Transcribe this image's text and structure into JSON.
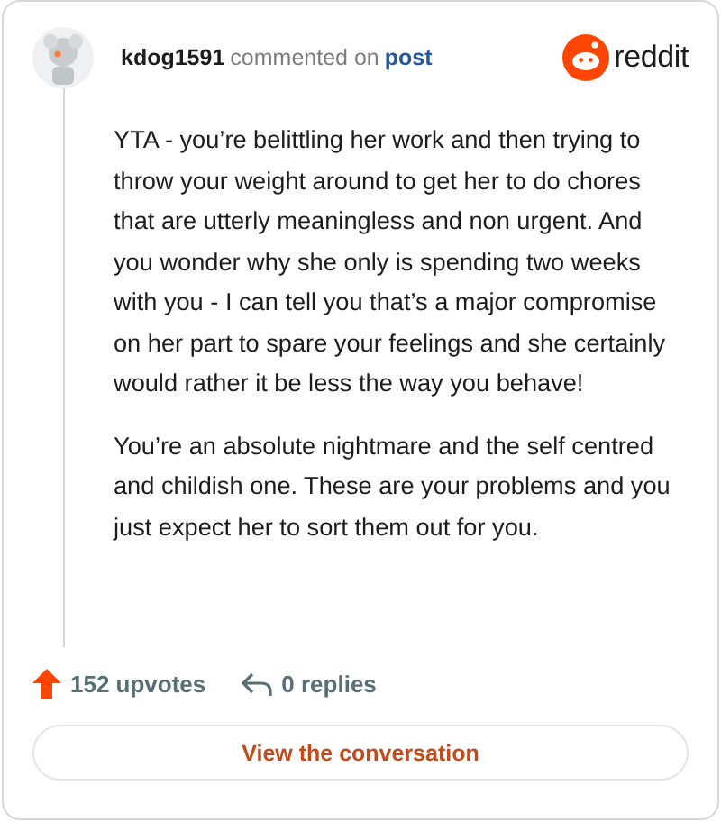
{
  "comment": {
    "author": "kdog1591",
    "action": "commented on",
    "target": "post",
    "brand": "reddit",
    "paragraphs": [
      "YTA - you’re belittling her work and then trying to throw your weight around to get her to do chores that are utterly meaningless and non urgent. And you wonder why she only is spending two weeks with you - I can tell you that’s a major compromise on her part to spare your feelings and she certainly would rather it be less the way you behave!",
      "You’re an absolute nightmare and the self centred and childish one. These are your problems and you just expect her to sort them out for you."
    ],
    "upvotes": "152 upvotes",
    "replies": "0 replies",
    "button": "View the conversation"
  }
}
